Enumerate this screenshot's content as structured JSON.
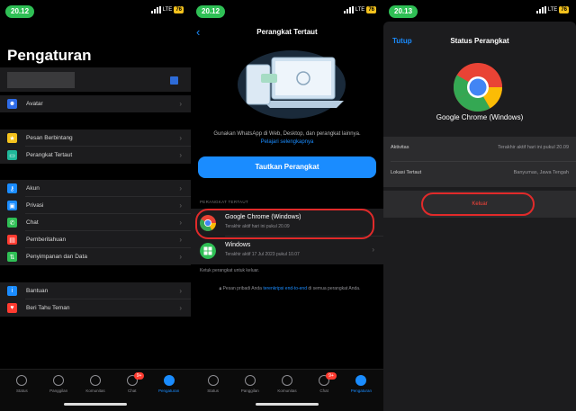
{
  "colors": {
    "accent": "#1a8cff",
    "highlight": "#e12a2a",
    "status_pill": "#2fbf55",
    "danger": "#ff453a"
  },
  "status_bar": {
    "time": "20.12",
    "time_s3": "20.13",
    "network": "LTE",
    "battery": "76"
  },
  "settings": {
    "title": "Pengaturan",
    "qr_icon": "qr-code-icon",
    "groups": [
      [
        {
          "label": "Avatar",
          "icon": "avatar-icon",
          "color": "#2e6be6"
        }
      ],
      [
        {
          "label": "Pesan Berbintang",
          "icon": "star-icon",
          "color": "#f4c21d"
        },
        {
          "label": "Perangkat Tertaut",
          "icon": "laptop-icon",
          "color": "#1fb89a"
        }
      ],
      [
        {
          "label": "Akun",
          "icon": "key-icon",
          "color": "#1a8cff"
        },
        {
          "label": "Privasi",
          "icon": "lock-icon",
          "color": "#1a8cff"
        },
        {
          "label": "Chat",
          "icon": "whatsapp-icon",
          "color": "#2fbf55"
        },
        {
          "label": "Pemberitahuan",
          "icon": "bell-icon",
          "color": "#ff3b30"
        },
        {
          "label": "Penyimpanan dan Data",
          "icon": "storage-icon",
          "color": "#2fbf55"
        }
      ],
      [
        {
          "label": "Bantuan",
          "icon": "info-icon",
          "color": "#1a8cff"
        },
        {
          "label": "Beri Tahu Teman",
          "icon": "heart-icon",
          "color": "#ff3b30"
        }
      ]
    ]
  },
  "tabbar": {
    "items": [
      {
        "label": "Status"
      },
      {
        "label": "Panggilan"
      },
      {
        "label": "Komunitas"
      },
      {
        "label": "Chat",
        "badge": "9+"
      },
      {
        "label": "Pengaturan"
      }
    ]
  },
  "linked": {
    "title": "Perangkat Tertaut",
    "back": "‹",
    "desc": "Gunakan WhatsApp di Web, Desktop, dan perangkat lainnya.",
    "desc_link": "Pelajari selengkapnya",
    "button": "Tautkan Perangkat",
    "section": "PERANGKAT TERTAUT",
    "devices": [
      {
        "name": "Google Chrome (Windows)",
        "sub": "Terakhir aktif hari ini pukul 20.09"
      },
      {
        "name": "Windows",
        "sub": "Terakhir aktif 17 Jul 2023 pukul 10.07"
      }
    ],
    "note": "Ketuk perangkat untuk keluar.",
    "enc_pre": "Pesan pribadi Anda",
    "enc_link": "terenkripsi end-to-end",
    "enc_post": "di semua perangkat Anda."
  },
  "device_status": {
    "close": "Tutup",
    "title": "Status Perangkat",
    "device": "Google Chrome (Windows)",
    "rows": [
      {
        "key": "Aktivitas",
        "value": "Terakhir aktif hari ini pukul 20.09"
      },
      {
        "key": "Lokasi Tertaut",
        "value": "Banyumas, Jawa Tengah"
      }
    ],
    "logout": "Keluar"
  }
}
